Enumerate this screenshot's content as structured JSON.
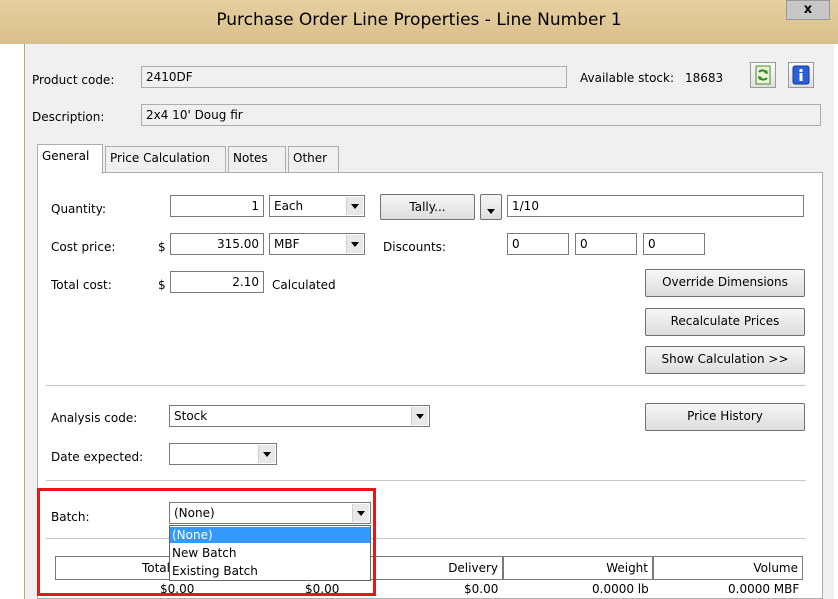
{
  "window": {
    "title": "Purchase Order Line Properties - Line Number 1",
    "close_label": "x"
  },
  "header": {
    "product_code_label": "Product code:",
    "product_code_value": "2410DF",
    "available_stock_label": "Available stock:",
    "available_stock_value": "18683",
    "description_label": "Description:",
    "description_value": "2x4 10' Doug fir",
    "refresh_icon": "refresh-icon",
    "info_icon": "info-icon"
  },
  "tabs": [
    {
      "label": "General",
      "active": true
    },
    {
      "label": "Price Calculation",
      "active": false
    },
    {
      "label": "Notes",
      "active": false
    },
    {
      "label": "Other",
      "active": false
    }
  ],
  "general": {
    "quantity_label": "Quantity:",
    "quantity_value": "1",
    "quantity_unit": "Each",
    "tally_label": "Tally...",
    "tally_value": "1/10",
    "cost_price_label": "Cost price:",
    "currency_symbol": "$",
    "cost_price_value": "315.00",
    "cost_price_unit": "MBF",
    "discounts_label": "Discounts:",
    "discounts": [
      "0",
      "0",
      "0"
    ],
    "total_cost_label": "Total cost:",
    "total_cost_value": "2.10",
    "calculated_label": "Calculated",
    "override_dimensions_label": "Override Dimensions",
    "recalculate_prices_label": "Recalculate Prices",
    "show_calculation_label": "Show Calculation >>",
    "analysis_code_label": "Analysis code:",
    "analysis_code_value": "Stock",
    "price_history_label": "Price History",
    "date_expected_label": "Date expected:",
    "date_expected_value": "",
    "batch_label": "Batch:",
    "batch_value": "(None)",
    "batch_options": [
      "(None)",
      "New Batch",
      "Existing Batch"
    ]
  },
  "totals_table": {
    "headers": [
      "Total",
      "Delivery",
      "Weight",
      "Volume"
    ],
    "values": [
      "$0.00",
      "$0.00",
      "$0.00",
      "0.0000 lb",
      "0.0000 MBF"
    ]
  },
  "colors": {
    "title_bar": "#d9bf8c",
    "highlight_box": "#e8151b",
    "selected_option": "#3399ff"
  }
}
